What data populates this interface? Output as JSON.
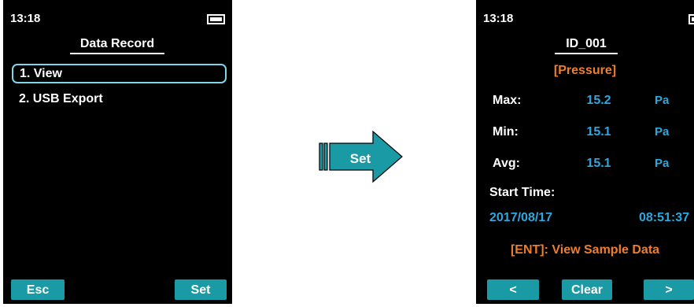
{
  "colors": {
    "screen_bg": "#000000",
    "soft_key": "#1a9aa5",
    "selection_border": "#7fd6e6",
    "value_blue": "#29a9e0",
    "accent_orange": "#ef7e2b",
    "arrow_teal": "#1a9aa5"
  },
  "left_screen": {
    "time": "13:18",
    "battery_icon": "battery-full-icon",
    "title": "Data Record",
    "menu_items": [
      {
        "label": "1. View",
        "selected": true
      },
      {
        "label": "2. USB Export",
        "selected": false
      }
    ],
    "left_key": "Esc",
    "right_key": "Set"
  },
  "transition_arrow": {
    "label": "Set",
    "icon": "right-arrow-icon"
  },
  "right_screen": {
    "time": "13:18",
    "battery_icon": "battery-full-icon",
    "title": "ID_001",
    "category": "[Pressure]",
    "rows": [
      {
        "label": "Max:",
        "value": "15.2",
        "unit": "Pa"
      },
      {
        "label": "Min:",
        "value": "15.1",
        "unit": "Pa"
      },
      {
        "label": "Avg:",
        "value": "15.1",
        "unit": "Pa"
      }
    ],
    "start_time_label": "Start Time:",
    "start_date": "2017/08/17",
    "start_clock": "08:51:37",
    "hint": "[ENT]: View Sample Data",
    "left_key": "<",
    "middle_key": "Clear",
    "right_key": ">"
  }
}
